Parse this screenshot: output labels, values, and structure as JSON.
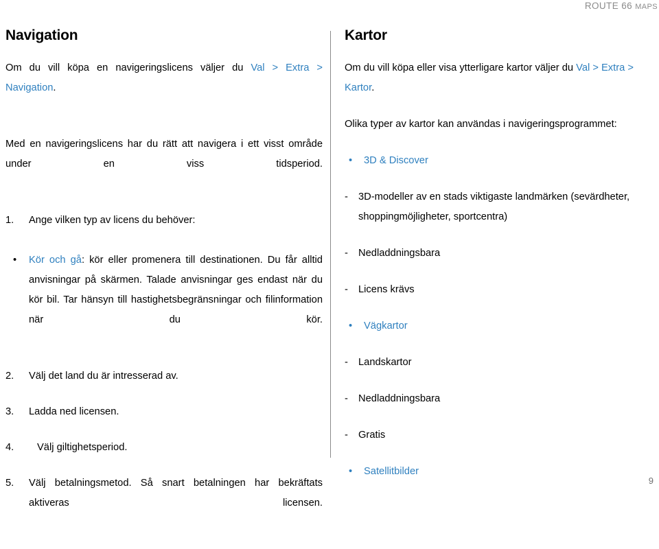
{
  "header": {
    "brand_main": "ROUTE 66 ",
    "brand_small": "MAPS"
  },
  "left_column": {
    "title": "Navigation",
    "intro_prefix": "Om du vill köpa en navigeringslicens väljer du ",
    "intro_path": "Val > Extra > Navigation",
    "intro_suffix": ".",
    "paragraph": "Med en navigeringslicens har du rätt att navigera i ett visst område under en viss tidsperiod.",
    "steps": [
      {
        "num": "1.",
        "text": "Ange vilken typ av licens du behöver:"
      },
      {
        "num": "2.",
        "text": "Välj det land du är intresserad av."
      },
      {
        "num": "3.",
        "text": "Ladda ned licensen."
      },
      {
        "num": "4.",
        "text": "Välj giltighetsperiod."
      },
      {
        "num": "5.",
        "text": "Välj betalningsmetod. Så snart betalningen har bekräftats aktiveras licensen."
      }
    ],
    "bullet": {
      "marker": "•",
      "highlight": "Kör och gå",
      "text": ": kör eller promenera till destinationen. Du får alltid anvisningar på skärmen. Talade anvisningar ges endast när du kör bil. Tar hänsyn till hastighetsbegränsningar och filinformation när du kör."
    }
  },
  "right_column": {
    "title": "Kartor",
    "intro_prefix": "Om du vill köpa eller visa ytterligare kartor väljer du ",
    "intro_path": "Val > Extra > Kartor",
    "intro_suffix": ".",
    "paragraph": "Olika typer av kartor kan användas i navigeringsprogrammet:",
    "map_types": [
      {
        "marker": "•",
        "name": "3D & Discover",
        "features": [
          {
            "dash": "-",
            "text": "3D-modeller av en stads viktigaste landmärken (sevärdheter, shoppingmöjligheter, sportcentra)"
          },
          {
            "dash": "-",
            "text": "Nedladdningsbara"
          },
          {
            "dash": "-",
            "text": "Licens krävs"
          }
        ]
      },
      {
        "marker": "•",
        "name": "Vägkartor",
        "features": [
          {
            "dash": "-",
            "text": "Landskartor"
          },
          {
            "dash": "-",
            "text": "Nedladdningsbara"
          },
          {
            "dash": "-",
            "text": "Gratis"
          }
        ]
      },
      {
        "marker": "•",
        "name": "Satellitbilder",
        "features": []
      }
    ]
  },
  "footer": {
    "page_number": "9"
  },
  "colors": {
    "accent_blue": "#2f80bf",
    "header_gray": "#8b8b8b",
    "divider_gray": "#8a8a8a"
  }
}
